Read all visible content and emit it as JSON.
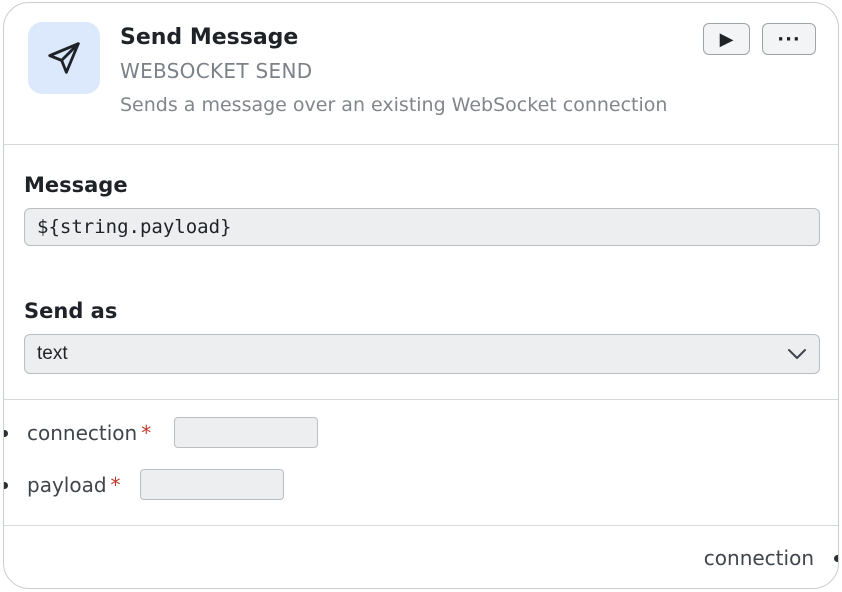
{
  "node": {
    "title": "Send Message",
    "type_label": "WEBSOCKET SEND",
    "description": "Sends a message over an existing WebSocket connection",
    "icon": "send-icon",
    "accent_color": "#dce8fb"
  },
  "actions": {
    "run_label": "▶",
    "more_label": "···"
  },
  "fields": {
    "message": {
      "label": "Message",
      "value": "${string.payload}"
    },
    "send_as": {
      "label": "Send as",
      "selected": "text"
    }
  },
  "inputs": [
    {
      "name": "connection",
      "required_mark": "*",
      "value": ""
    },
    {
      "name": "payload",
      "required_mark": "*",
      "value": ""
    }
  ],
  "outputs": [
    {
      "name": "connection"
    }
  ]
}
